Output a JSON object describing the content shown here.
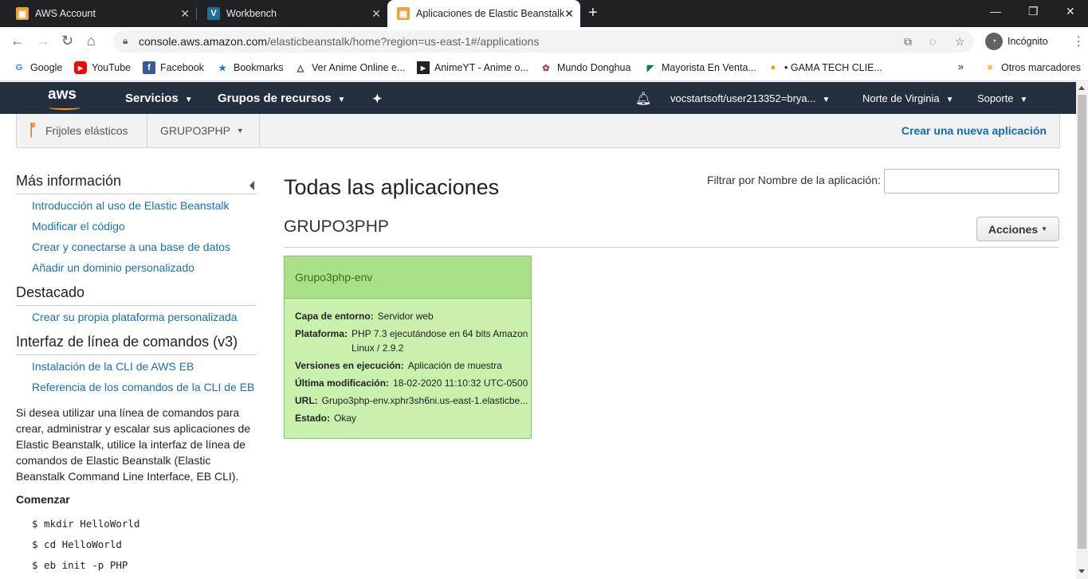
{
  "browser": {
    "tabs": [
      {
        "title": "AWS Account"
      },
      {
        "title": "Workbench"
      },
      {
        "title": "Aplicaciones de Elastic Beanstalk"
      }
    ],
    "url_host": "console.aws.amazon.com",
    "url_path": "/elasticbeanstalk/home?region=us-east-1#/applications",
    "profile_label": "Incógnito",
    "bookmarks": [
      {
        "label": "Google"
      },
      {
        "label": "YouTube"
      },
      {
        "label": "Facebook"
      },
      {
        "label": "Bookmarks"
      },
      {
        "label": "Ver Anime Online e..."
      },
      {
        "label": "AnimeYT - Anime o..."
      },
      {
        "label": "Mundo Donghua"
      },
      {
        "label": "Mayorista En Venta..."
      },
      {
        "label": "• GAMA TECH CLIE..."
      }
    ],
    "other_bookmarks": "Otros marcadores",
    "overflow": "»"
  },
  "aws_nav": {
    "logo": "aws",
    "services": "Servicios",
    "resource_groups": "Grupos de recursos",
    "account": "vocstartsoft/user213352=brya...",
    "region": "Norte de Virginia",
    "support": "Soporte"
  },
  "subheader": {
    "service": "Frijoles elásticos",
    "app_selector": "GRUPO3PHP",
    "create_app": "Crear una nueva aplicación"
  },
  "sidebar": {
    "more_info_title": "Más información",
    "more_info_links": [
      "Introducción al uso de Elastic Beanstalk",
      "Modificar el código",
      "Crear y conectarse a una base de datos",
      "Añadir un dominio personalizado"
    ],
    "featured_title": "Destacado",
    "featured_links": [
      "Crear su propia plataforma personalizada"
    ],
    "cli_title": "Interfaz de línea de comandos (v3)",
    "cli_links": [
      "Instalación de la CLI de AWS EB",
      "Referencia de los comandos de la CLI de EB"
    ],
    "cli_description": "Si desea utilizar una línea de comandos para crear, administrar y escalar sus aplicaciones de Elastic Beanstalk, utilice la interfaz de línea de comandos de Elastic Beanstalk (Elastic Beanstalk Command Line Interface, EB CLI).",
    "start_title": "Comenzar",
    "commands": [
      "$ mkdir HelloWorld",
      "$ cd HelloWorld",
      "$ eb init -p PHP"
    ]
  },
  "main": {
    "title": "Todas las aplicaciones",
    "filter_label": "Filtrar por Nombre de la aplicación:",
    "filter_value": "",
    "application_name": "GRUPO3PHP",
    "actions_label": "Acciones",
    "environment": {
      "name": "Grupo3php-env",
      "tier_label": "Capa de entorno:",
      "tier_value": "Servidor web",
      "platform_label": "Plataforma:",
      "platform_value_1": "PHP 7.3 ejecutándose en 64 bits Amazon",
      "platform_value_2": "Linux / 2.9.2",
      "versions_label": "Versiones en ejecución:",
      "versions_value": "Aplicación de muestra",
      "modified_label": "Última modificación:",
      "modified_value": "18-02-2020 11:10:32 UTC-0500",
      "url_label": "URL:",
      "url_value": "Grupo3php-env.xphr3sh6ni.us-east-1.elasticbe...",
      "status_label": "Estado:",
      "status_value": "Okay"
    }
  }
}
